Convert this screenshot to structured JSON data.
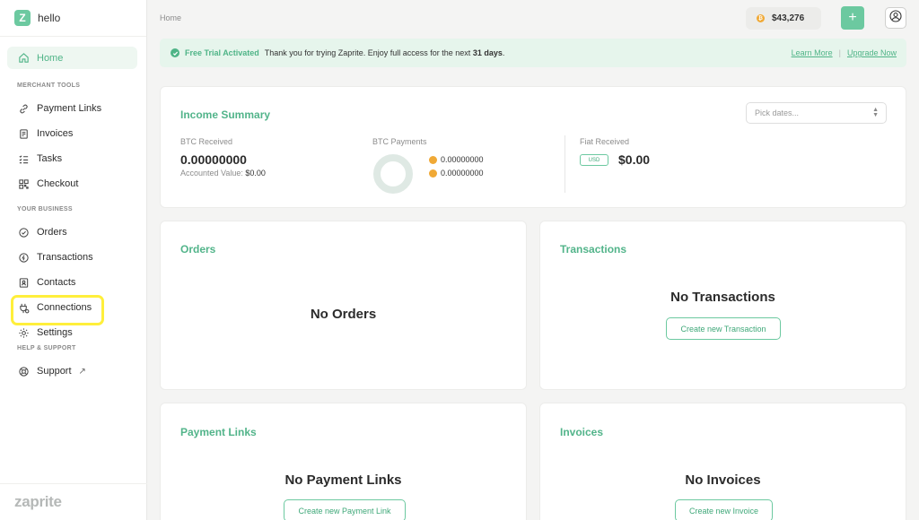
{
  "brand": {
    "logo_letter": "Z",
    "name": "hello",
    "footer": "zaprite"
  },
  "sidebar": {
    "home": "Home",
    "merchant_section": "MERCHANT TOOLS",
    "merchant_items": [
      "Payment Links",
      "Invoices",
      "Tasks",
      "Checkout"
    ],
    "business_section": "YOUR BUSINESS",
    "business_items": [
      "Orders",
      "Transactions",
      "Contacts",
      "Connections",
      "Settings"
    ],
    "help_section": "HELP & SUPPORT",
    "support": "Support",
    "support_arrow": "↗"
  },
  "topbar": {
    "breadcrumb": "Home",
    "btc_price": "$43,276",
    "btc_symbol": "₿",
    "add_symbol": "+"
  },
  "banner": {
    "title": "Free Trial Activated",
    "text_pre": "Thank you for trying Zaprite. Enjoy full access for the next ",
    "days": "31 days",
    "text_post": ".",
    "learn_more": "Learn More",
    "separator": "|",
    "upgrade": "Upgrade Now"
  },
  "income": {
    "title": "Income Summary",
    "date_placeholder": "Pick dates...",
    "btc_received_label": "BTC Received",
    "btc_received_value": "0.00000000",
    "accounted_label": "Accounted Value:",
    "accounted_value": "$0.00",
    "btc_payments_label": "BTC Payments",
    "btc_onchain": "0.00000000",
    "btc_lightning": "0.00000000",
    "fiat_label": "Fiat Received",
    "fiat_currency": "USD",
    "fiat_value": "$0.00"
  },
  "orders": {
    "title": "Orders",
    "empty": "No Orders"
  },
  "transactions": {
    "title": "Transactions",
    "empty": "No Transactions",
    "button": "Create new Transaction"
  },
  "payment_links": {
    "title": "Payment Links",
    "empty": "No Payment Links",
    "button": "Create new Payment Link"
  },
  "invoices": {
    "title": "Invoices",
    "empty": "No Invoices",
    "button": "Create new Invoice"
  },
  "colors": {
    "accent": "#6cc9a0",
    "accent_text": "#4fb487",
    "highlight": "#ffef3b",
    "bitcoin": "#f0a936"
  }
}
